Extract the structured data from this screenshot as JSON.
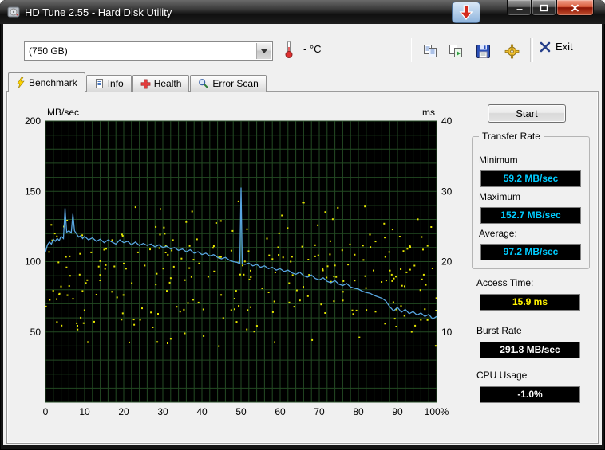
{
  "window": {
    "title": "HD Tune 2.55 - Hard Disk Utility"
  },
  "toolbar": {
    "drive_select": "(750 GB)",
    "temperature": "- °C",
    "exit_label": "Exit"
  },
  "tabs": {
    "benchmark": "Benchmark",
    "info": "Info",
    "health": "Health",
    "error_scan": "Error Scan"
  },
  "results": {
    "start_label": "Start",
    "transfer_rate": {
      "title": "Transfer Rate",
      "minimum_label": "Minimum",
      "minimum_value": "59.2 MB/sec",
      "maximum_label": "Maximum",
      "maximum_value": "152.7 MB/sec",
      "average_label": "Average:",
      "average_value": "97.2 MB/sec"
    },
    "access_time": {
      "label": "Access Time:",
      "value": "15.9 ms"
    },
    "burst_rate": {
      "label": "Burst Rate",
      "value": "291.8 MB/sec"
    },
    "cpu_usage": {
      "label": "CPU Usage",
      "value": "-1.0%"
    }
  },
  "colors": {
    "transfer_value": "#00ccff",
    "access_value": "#fff200",
    "plain_value": "#ffffff"
  },
  "chart_data": {
    "type": "line",
    "title": "HD Tune benchmark graph",
    "left_axis": {
      "label": "MB/sec",
      "range": [
        0,
        200
      ],
      "ticks": [
        50,
        100,
        150,
        200
      ]
    },
    "right_axis": {
      "label": "ms",
      "range": [
        0,
        40
      ],
      "ticks": [
        10,
        20,
        30,
        40
      ]
    },
    "x_axis": {
      "range": [
        0,
        100
      ],
      "tick_labels": [
        "0",
        "10",
        "20",
        "30",
        "40",
        "50",
        "60",
        "70",
        "80",
        "90",
        "100%"
      ]
    },
    "grid": {
      "x_step": 2,
      "y_step": 10,
      "color": "#234a23",
      "background": "#000000"
    },
    "series": [
      {
        "name": "Transfer Rate",
        "axis": "left",
        "color": "#58a6e0",
        "points": [
          [
            0,
            107
          ],
          [
            0.5,
            112
          ],
          [
            1,
            114
          ],
          [
            1.5,
            112.5
          ],
          [
            2,
            116
          ],
          [
            2.5,
            114.5
          ],
          [
            3,
            116.5
          ],
          [
            3.5,
            115
          ],
          [
            4,
            118
          ],
          [
            4.6,
            116.5
          ],
          [
            5,
            138
          ],
          [
            5.4,
            121
          ],
          [
            6,
            122
          ],
          [
            6.6,
            120.5
          ],
          [
            7,
            134
          ],
          [
            7.4,
            122
          ],
          [
            8,
            119.5
          ],
          [
            8.5,
            117.5
          ],
          [
            9,
            118.5
          ],
          [
            9.5,
            116.5
          ],
          [
            10,
            118
          ],
          [
            11,
            115.5
          ],
          [
            12,
            117
          ],
          [
            13,
            114.5
          ],
          [
            14,
            116
          ],
          [
            15,
            113.5
          ],
          [
            16,
            115.5
          ],
          [
            17,
            114
          ],
          [
            18,
            112.5
          ],
          [
            19,
            115.5
          ],
          [
            20,
            113.5
          ],
          [
            21,
            114.5
          ],
          [
            22,
            112
          ],
          [
            23,
            114
          ],
          [
            24,
            111.5
          ],
          [
            25,
            113
          ],
          [
            26,
            111.5
          ],
          [
            27,
            112.5
          ],
          [
            28,
            110.5
          ],
          [
            29,
            112
          ],
          [
            30,
            110
          ],
          [
            31,
            111
          ],
          [
            32,
            109
          ],
          [
            33,
            110
          ],
          [
            34,
            108
          ],
          [
            35,
            109
          ],
          [
            36,
            107
          ],
          [
            37,
            108.5
          ],
          [
            38,
            106
          ],
          [
            39,
            107
          ],
          [
            40,
            105
          ],
          [
            41,
            106
          ],
          [
            42,
            104
          ],
          [
            43,
            105
          ],
          [
            44,
            103
          ],
          [
            45,
            102
          ],
          [
            46,
            103
          ],
          [
            47,
            101
          ],
          [
            48,
            100
          ],
          [
            49,
            99.5
          ],
          [
            49.7,
            98.5
          ],
          [
            50,
            152.7
          ],
          [
            50.3,
            98.5
          ],
          [
            51,
            98
          ],
          [
            52,
            99
          ],
          [
            53,
            97
          ],
          [
            54,
            98
          ],
          [
            55,
            96
          ],
          [
            56,
            97
          ],
          [
            57,
            95
          ],
          [
            58,
            96
          ],
          [
            59,
            94
          ],
          [
            60,
            95
          ],
          [
            61,
            93
          ],
          [
            62,
            94
          ],
          [
            63,
            92
          ],
          [
            64,
            91
          ],
          [
            65,
            92.5
          ],
          [
            66,
            90
          ],
          [
            67,
            89
          ],
          [
            68,
            90.5
          ],
          [
            69,
            88
          ],
          [
            70,
            87
          ],
          [
            71,
            88.5
          ],
          [
            72,
            86
          ],
          [
            73,
            85
          ],
          [
            74,
            86.5
          ],
          [
            75,
            84
          ],
          [
            76,
            83
          ],
          [
            77,
            84.5
          ],
          [
            78,
            82
          ],
          [
            79,
            81
          ],
          [
            80,
            80.5
          ],
          [
            81,
            79
          ],
          [
            82,
            78
          ],
          [
            83,
            77.5
          ],
          [
            84,
            76
          ],
          [
            85,
            75
          ],
          [
            86,
            74
          ],
          [
            87,
            72
          ],
          [
            88,
            68
          ],
          [
            89,
            65
          ],
          [
            90,
            67.5
          ],
          [
            91,
            64
          ],
          [
            92,
            66
          ],
          [
            93,
            63
          ],
          [
            94,
            64.5
          ],
          [
            95,
            62
          ],
          [
            96,
            63.5
          ],
          [
            97,
            61
          ],
          [
            98,
            62.5
          ],
          [
            99,
            59.2
          ],
          [
            100,
            61
          ]
        ]
      }
    ],
    "scatter": {
      "name": "Access Time",
      "axis": "right",
      "color": "#e6e600",
      "count": 270,
      "seed": 123456789,
      "ms_min": 7,
      "ms_max": 29
    },
    "summary": {
      "minimum_mb_s": 59.2,
      "maximum_mb_s": 152.7,
      "average_mb_s": 97.2,
      "access_time_ms": 15.9,
      "burst_rate_mb_s": 291.8,
      "cpu_usage_pct": -1.0
    }
  }
}
